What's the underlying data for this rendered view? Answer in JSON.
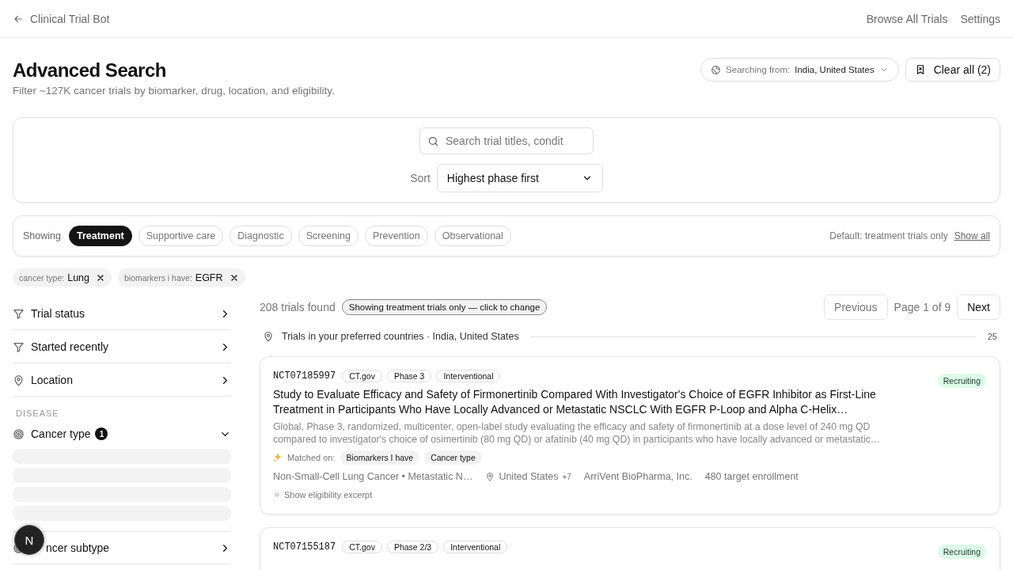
{
  "header": {
    "back_label": "Clinical Trial Bot",
    "nav": [
      "Browse All Trials",
      "Settings"
    ]
  },
  "page": {
    "title": "Advanced Search",
    "subtitle": "Filter ~127K cancer trials by biomarker, drug, location, and eligibility.",
    "searching_from_label": "Searching from:",
    "searching_from_value": "India, United States",
    "clear_all": "Clear all (2)"
  },
  "search": {
    "placeholder": "Search trial titles, condit",
    "sort_label": "Sort",
    "sort_value": "Highest phase first"
  },
  "type_filter": {
    "label": "Showing",
    "options": [
      {
        "label": "Treatment",
        "selected": true
      },
      {
        "label": "Supportive care",
        "selected": false
      },
      {
        "label": "Diagnostic",
        "selected": false
      },
      {
        "label": "Screening",
        "selected": false
      },
      {
        "label": "Prevention",
        "selected": false
      },
      {
        "label": "Observational",
        "selected": false
      }
    ],
    "default_note": "Default: treatment trials only",
    "show_all": "Show all"
  },
  "active_filters": [
    {
      "key": "cancer type:",
      "value": "Lung"
    },
    {
      "key": "biomarkers i have:",
      "value": "EGFR"
    }
  ],
  "sidebar": [
    {
      "kind": "status",
      "label": "Trial status",
      "expanded": false
    },
    {
      "kind": "date",
      "label": "Started recently",
      "expanded": false
    },
    {
      "kind": "location",
      "label": "Location",
      "expanded": false
    },
    {
      "kind": "heading",
      "label": "DISEASE"
    },
    {
      "kind": "disease",
      "label": "Cancer type",
      "badge": "1",
      "expanded": true,
      "loading": true
    },
    {
      "kind": "disease",
      "label": "ncer subtype",
      "expanded": false
    }
  ],
  "floating_button": "N",
  "results": {
    "count": "208 trials found",
    "notice": "Showing treatment trials only — click to change",
    "previous": "Previous",
    "page": "Page 1 of 9",
    "next": "Next",
    "group_label": "Trials in your preferred countries · India, United States",
    "group_count": "25",
    "trials": [
      {
        "id": "NCT07185997",
        "tags": [
          "CT.gov",
          "Phase 3",
          "Interventional"
        ],
        "status": "Recruiting",
        "title": "Study to Evaluate Efficacy and Safety of Firmonertinib Compared With Investigator's Choice of EGFR Inhibitor as First-Line Treatment in Participants Who Have Locally Advanced or Metastatic NSCLC With EGFR P-Loop and Alpha C-Helix…",
        "summary": "Global, Phase 3, randomized, multicenter, open-label study evaluating the efficacy and safety of firmonertinib at a dose level of 240 mg QD compared to investigator's choice of osimertinib (80 mg QD) or afatinib (40 mg QD) in participants who have locally advanced or metastatic…",
        "matched_label": "Matched on:",
        "matched": [
          "Biomarkers I have",
          "Cancer type"
        ],
        "conditions": "Non-Small-Cell Lung Cancer • Metastatic N…",
        "location": "United States",
        "location_more": "+7",
        "sponsor": "ArriVent BioPharma, Inc.",
        "enrollment": "480 target enrollment",
        "excerpt_link": "Show eligibility excerpt"
      },
      {
        "id": "NCT07155187",
        "tags": [
          "CT.gov",
          "Phase 2/3",
          "Interventional"
        ],
        "status": "Recruiting"
      }
    ]
  }
}
